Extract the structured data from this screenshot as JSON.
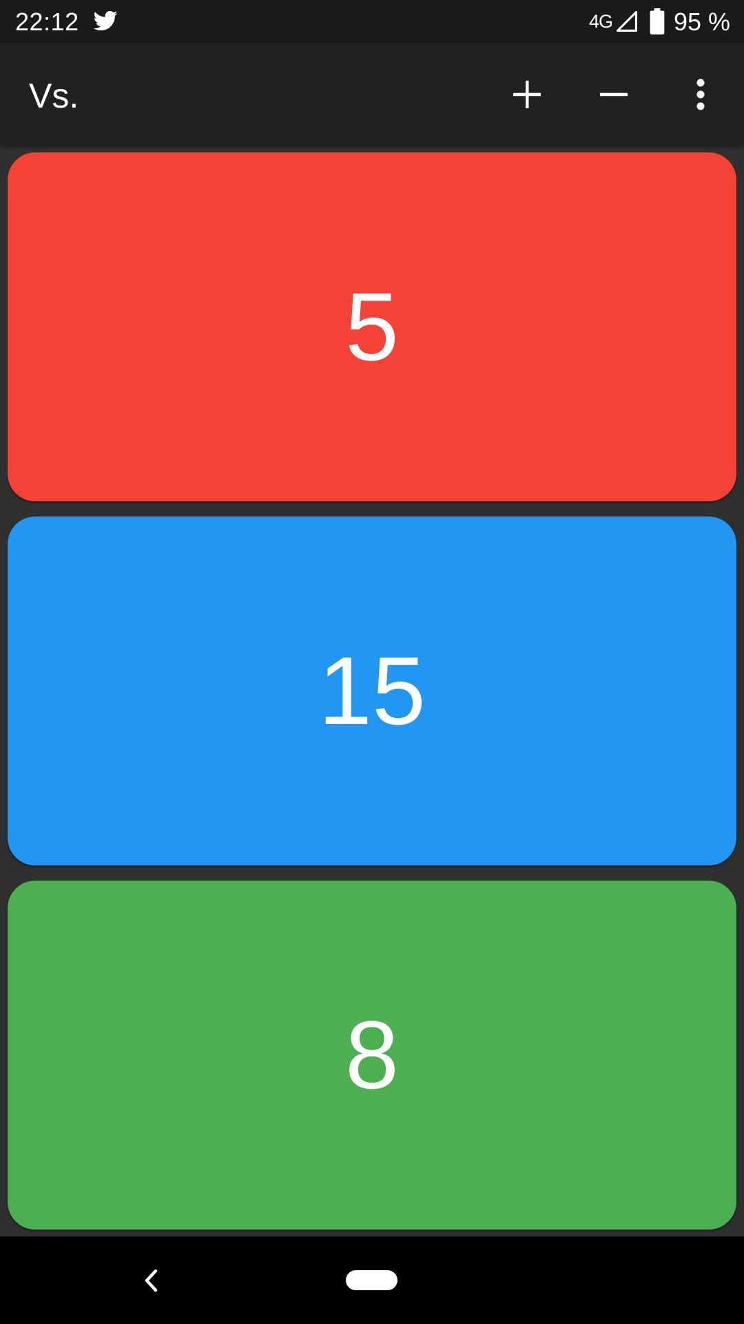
{
  "status_bar": {
    "time": "22:12",
    "notification_icon": "twitter-bird-icon",
    "network": "4G",
    "signal_icon": "cell-signal-icon",
    "battery_icon": "battery-icon",
    "battery_text": "95 %"
  },
  "app_bar": {
    "title": "Vs.",
    "actions": [
      {
        "icon": "plus-icon",
        "label": "+"
      },
      {
        "icon": "minus-icon",
        "label": "−"
      },
      {
        "icon": "more-vert-icon",
        "label": "⋮"
      }
    ]
  },
  "counters": [
    {
      "value": "5",
      "color": "#F44336"
    },
    {
      "value": "15",
      "color": "#2196F3"
    },
    {
      "value": "8",
      "color": "#4CAF50"
    }
  ],
  "nav_bar": {
    "back_icon": "back-chevron-icon",
    "home_icon": "home-pill-icon"
  },
  "colors": {
    "status_bar_bg": "#1B1B1B",
    "app_bar_bg": "#212121",
    "content_bg": "#303030",
    "nav_bar_bg": "#000000"
  }
}
